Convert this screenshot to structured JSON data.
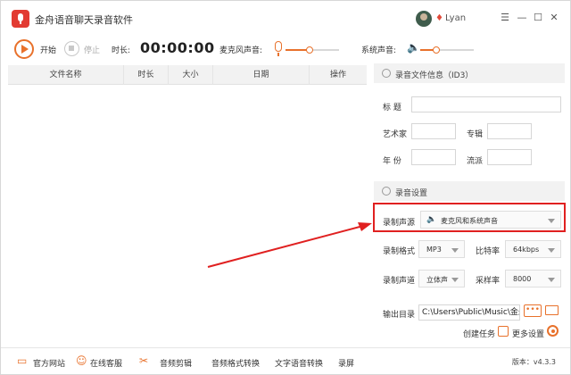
{
  "window": {
    "title": "金舟语音聊天录音软件",
    "username": "Lyan",
    "controls": [
      "menu",
      "minimize",
      "maximize",
      "close"
    ]
  },
  "toolbar": {
    "start_label": "开始",
    "stop_label": "停止",
    "duration_label": "时长:",
    "duration_value": "00:00:00",
    "mic_label": "麦克风声音:",
    "mic_level": 0.45,
    "system_label": "系统声音:",
    "system_level": 0.3
  },
  "table": {
    "columns": [
      "文件名称",
      "时长",
      "大小",
      "日期",
      "操作"
    ],
    "rows": []
  },
  "id3": {
    "title": "录音文件信息（ID3）",
    "fields": {
      "title_label": "标  题",
      "artist_label": "艺术家",
      "album_label": "专辑",
      "year_label": "年  份",
      "genre_label": "流派"
    }
  },
  "settings": {
    "title": "录音设置",
    "source_label": "录制声源",
    "source_value": "麦克风和系统声音",
    "format_label": "录制格式",
    "format_value": "MP3",
    "bitrate_label": "比特率",
    "bitrate_value": "64kbps",
    "channel_label": "录制声道",
    "channel_value": "立体声",
    "samplerate_label": "采样率",
    "samplerate_value": "8000",
    "output_label": "输出目录",
    "output_value": "C:\\Users\\Public\\Music\\金舟",
    "dots_label": "•••",
    "create_task_label": "创建任务",
    "more_settings_label": "更多设置"
  },
  "bottom": {
    "items": [
      "官方网站",
      "在线客服",
      "音频剪辑",
      "音频格式转换",
      "文字语音转换",
      "录屏"
    ],
    "version": "版本：v4.3.3"
  },
  "colors": {
    "accent": "#e8712b",
    "highlight": "#e02020",
    "logo": "#e23b32"
  }
}
